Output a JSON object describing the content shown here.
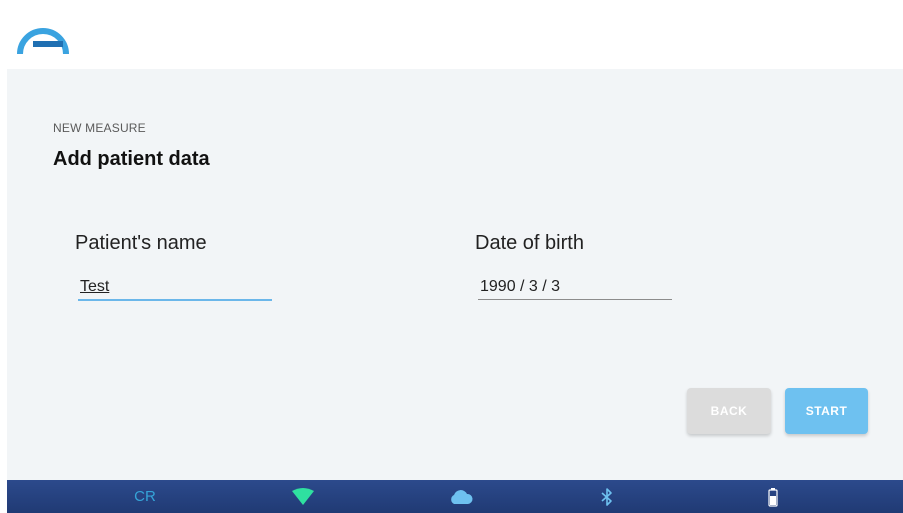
{
  "header": {
    "logo_icon": "brand-arc-logo",
    "logo_color": "#3aa3e0"
  },
  "page": {
    "subtitle": "NEW MEASURE",
    "title": "Add patient data"
  },
  "form": {
    "patient_name": {
      "label": "Patient's name",
      "value": "Test"
    },
    "date_of_birth": {
      "label": "Date of birth",
      "value": "1990 / 3 / 3"
    }
  },
  "actions": {
    "back_label": "BACK",
    "start_label": "START"
  },
  "status_bar": {
    "mode_label": "CR",
    "wifi_icon": "wifi-icon",
    "cloud_icon": "cloud-icon",
    "bluetooth_icon": "bluetooth-icon",
    "battery_icon": "battery-icon",
    "wifi_color": "#2fe0a0",
    "cloud_color": "#6ec1f0",
    "bluetooth_color": "#6ec1f0",
    "battery_color": "#ffffff"
  },
  "colors": {
    "accent": "#6ec1f0",
    "disabled": "#dcdcdc",
    "status_bar": "#203a74"
  }
}
